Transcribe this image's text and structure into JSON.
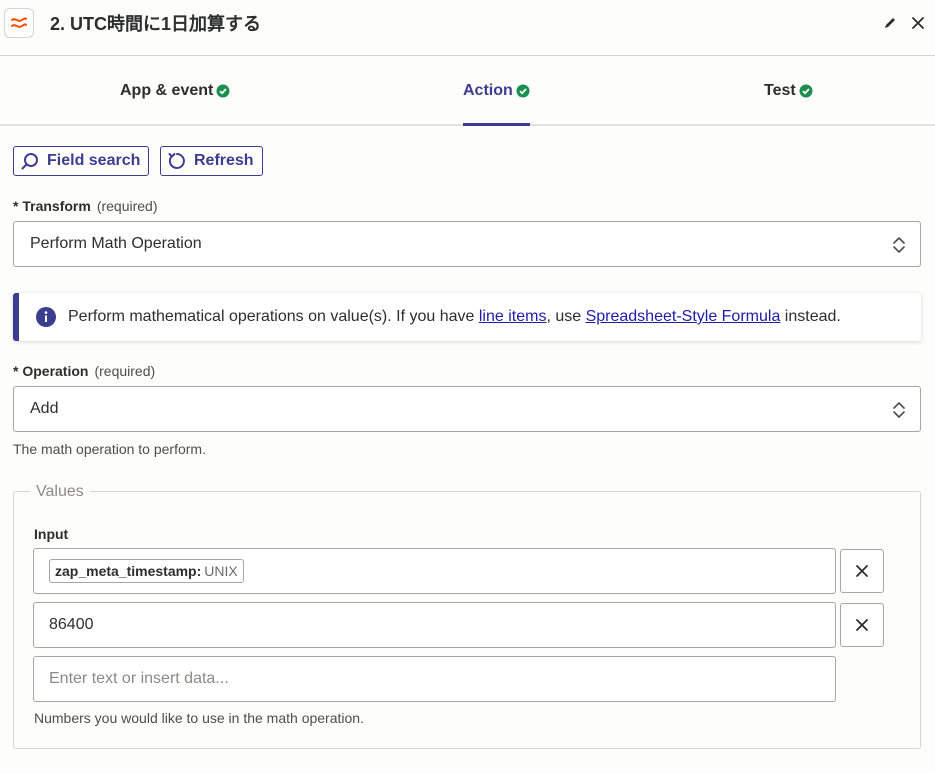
{
  "header": {
    "title": "2. UTC時間に1日加算する",
    "app_icon": "formatter-icon",
    "edit_icon": "pencil-icon",
    "close_icon": "close-icon"
  },
  "tabs": [
    {
      "label": "App & event",
      "complete": true
    },
    {
      "label": "Action",
      "complete": true,
      "active": true
    },
    {
      "label": "Test",
      "complete": true
    }
  ],
  "toolbar": {
    "field_search_label": "Field search",
    "refresh_label": "Refresh"
  },
  "transform": {
    "label": "Transform",
    "required_text": "(required)",
    "value": "Perform Math Operation"
  },
  "info_banner": {
    "text_before": "Perform mathematical operations on value(s). If you have ",
    "link1": "line items",
    "text_middle": ", use ",
    "link2": "Spreadsheet-Style Formula",
    "text_after": " instead."
  },
  "operation": {
    "label": "Operation",
    "required_text": "(required)",
    "value": "Add",
    "help": "The math operation to perform."
  },
  "values": {
    "legend": "Values",
    "input_label": "Input",
    "inputs": [
      {
        "pill_name": "zap_meta_timestamp:",
        "pill_sub": "UNIX"
      },
      {
        "value": "86400"
      },
      {
        "placeholder": "Enter text or insert data..."
      }
    ],
    "help": "Numbers you would like to use in the math operation."
  },
  "colors": {
    "accent": "#3b3d8f",
    "success": "#1a8f4e",
    "brand_orange": "#ff4f00",
    "link": "#1e1ea8"
  }
}
